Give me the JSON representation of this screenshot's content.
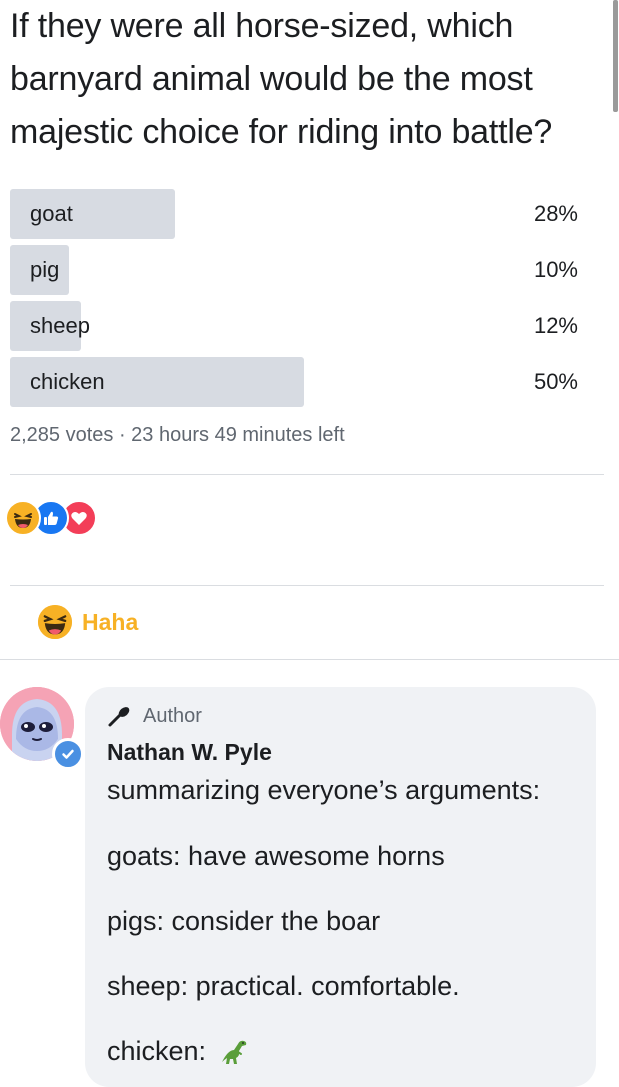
{
  "question": "If they were all horse-sized, which barnyard animal would be the most majestic choice for riding into battle?",
  "poll": {
    "options": [
      {
        "label": "goat",
        "percent_text": "28%",
        "fraction": 0.28
      },
      {
        "label": "pig",
        "percent_text": "10%",
        "fraction": 0.1
      },
      {
        "label": "sheep",
        "percent_text": "12%",
        "fraction": 0.12
      },
      {
        "label": "chicken",
        "percent_text": "50%",
        "fraction": 0.5
      }
    ],
    "meta": "2,285 votes · 23 hours 49 minutes left"
  },
  "reactions": {
    "icons": [
      "haha-icon",
      "like-icon",
      "love-icon"
    ]
  },
  "action": {
    "label": "Haha",
    "color": "#f7b125"
  },
  "comment": {
    "badge": "Author",
    "author": "Nathan W. Pyle",
    "lines": [
      "summarizing everyone’s arguments:",
      "goats: have awesome horns",
      "pigs: consider the boar",
      "sheep: practical. comfortable.",
      "chicken:"
    ],
    "chicken_icon": "dinosaur-icon"
  },
  "colors": {
    "bar": "#d7dbe2",
    "like": "#1877f2",
    "love": "#f33e58",
    "verified": "#4a90e2",
    "bubble": "#f0f2f5"
  }
}
